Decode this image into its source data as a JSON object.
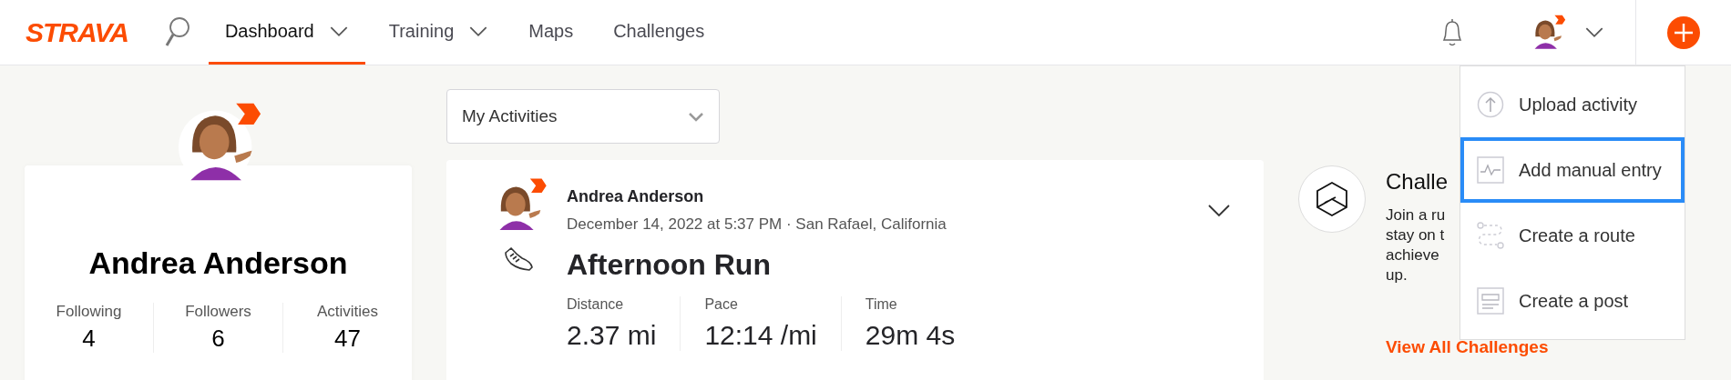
{
  "nav": {
    "logo": "STRAVA",
    "tabs": [
      {
        "label": "Dashboard",
        "selected": true,
        "has_caret": true
      },
      {
        "label": "Training",
        "selected": false,
        "has_caret": true
      },
      {
        "label": "Maps",
        "selected": false,
        "has_caret": false
      },
      {
        "label": "Challenges",
        "selected": false,
        "has_caret": false
      }
    ]
  },
  "profile": {
    "name": "Andrea Anderson",
    "stats": [
      {
        "label": "Following",
        "value": "4"
      },
      {
        "label": "Followers",
        "value": "6"
      },
      {
        "label": "Activities",
        "value": "47"
      }
    ]
  },
  "feed_filter": {
    "value": "My Activities"
  },
  "activity": {
    "athlete": "Andrea Anderson",
    "meta": "December 14, 2022 at 5:37 PM · San Rafael, California",
    "title": "Afternoon Run",
    "stats": [
      {
        "label": "Distance",
        "value": "2.37 mi"
      },
      {
        "label": "Pace",
        "value": "12:14 /mi"
      },
      {
        "label": "Time",
        "value": "29m 4s"
      }
    ]
  },
  "challenges": {
    "title": "Challe",
    "lines": [
      "Join a ru",
      "stay on t",
      "achieve",
      "up."
    ],
    "link": "View All Challenges"
  },
  "create_menu": {
    "items": [
      {
        "kind": "upload",
        "label": "Upload activity",
        "focused": false
      },
      {
        "kind": "manual",
        "label": "Add manual entry",
        "focused": true
      },
      {
        "kind": "route",
        "label": "Create a route",
        "focused": false
      },
      {
        "kind": "post",
        "label": "Create a post",
        "focused": false
      }
    ]
  }
}
